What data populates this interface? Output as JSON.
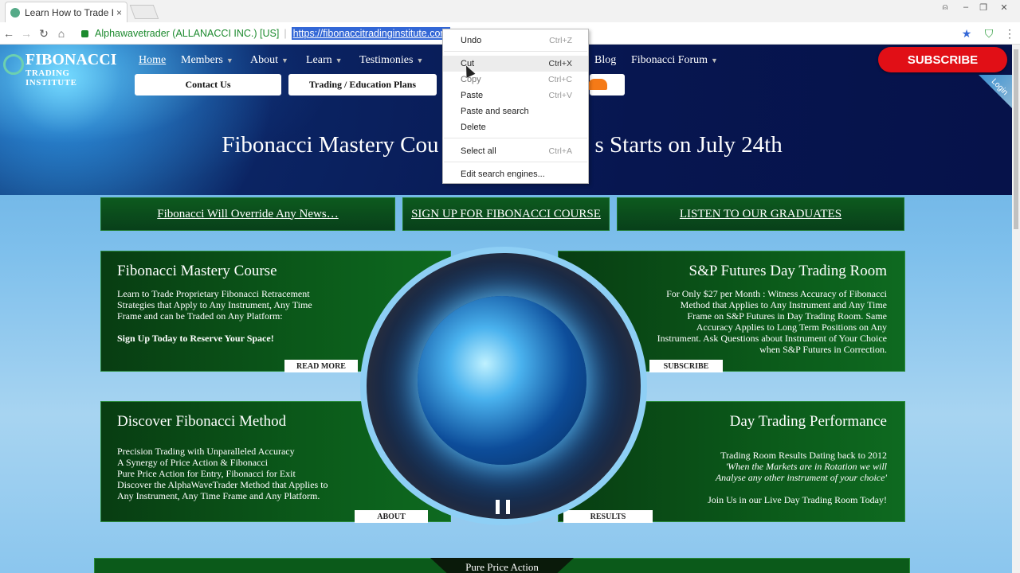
{
  "browser": {
    "tab_title": "Learn How to Trade Fibo",
    "tab_close": "×",
    "address": {
      "secure_label": "Alphawavetrader (ALLANACCI INC.) [US]",
      "url": "https://fibonaccitradinginstitute.com"
    },
    "window_buttons": [
      "⍝",
      "–",
      "❐",
      "✕"
    ]
  },
  "context_menu": {
    "items": [
      {
        "label": "Undo",
        "shortcut": "Ctrl+Z"
      },
      {
        "label": "Cut",
        "shortcut": "Ctrl+X"
      },
      {
        "label": "Copy",
        "shortcut": "Ctrl+C"
      },
      {
        "label": "Paste",
        "shortcut": "Ctrl+V"
      },
      {
        "label": "Paste and search",
        "shortcut": ""
      },
      {
        "label": "Delete",
        "shortcut": ""
      },
      {
        "label": "Select all",
        "shortcut": "Ctrl+A"
      },
      {
        "label": "Edit search engines...",
        "shortcut": ""
      }
    ]
  },
  "site": {
    "logo": {
      "line1": "FIBONACCI",
      "line2": "TRADING INSTITUTE"
    },
    "nav": {
      "home": "Home",
      "members": "Members",
      "about": "About",
      "learn": "Learn",
      "testimonies": "Testimonies",
      "blog": "Blog",
      "forum": "Fibonacci Forum"
    },
    "subscribe_button": "SUBSCRIBE",
    "login_corner": "Login",
    "sub_buttons": {
      "contact": "Contact Us",
      "plans": "Trading / Education Plans"
    },
    "hero_title_left": "Fibonacci Mastery Cou",
    "hero_title_right": "s Starts on July 24th",
    "green_buttons": {
      "news": "Fibonacci Will Override Any News…",
      "signup": "SIGN UP FOR FIBONACCI COURSE",
      "graduates": "LISTEN TO OUR GRADUATES"
    },
    "panels": {
      "mastery": {
        "title": "Fibonacci Mastery Course",
        "body": [
          "Learn to Trade Proprietary Fibonacci Retracement",
          "Strategies that Apply to Any Instrument, Any Time",
          "Frame and can be Traded on Any Platform:"
        ],
        "cta": "Sign Up Today to Reserve Your Space!",
        "button": "READ MORE"
      },
      "futures": {
        "title": "S&P Futures Day Trading Room",
        "body": [
          "For Only $27 per Month : Witness Accuracy of Fibonacci",
          "Method that Applies to Any Instrument and Any Time",
          "Frame on S&P Futures in Day Trading Room. Same",
          "Accuracy Applies to Long Term Positions on Any",
          "Instrument. Ask Questions about Instrument of Your Choice",
          "when S&P Futures in Correction."
        ],
        "button": "SUBSCRIBE"
      },
      "method": {
        "title": "Discover Fibonacci Method",
        "body": [
          "Precision Trading with Unparalleled Accuracy",
          "A Synergy of Price Action & Fibonacci",
          "Pure Price Action for Entry, Fibonacci for Exit",
          "Discover the AlphaWaveTrader Method that Applies to",
          "Any Instrument, Any Time Frame and Any Platform."
        ],
        "button": "ABOUT"
      },
      "performance": {
        "title": "Day Trading Performance",
        "body": [
          "Trading Room Results Dating back to 2012",
          "'When the Markets are in Rotation we will",
          "Analyse any other instrument of your choice'",
          "",
          "Join Us in our Live Day Trading Room Today!"
        ],
        "button": "RESULTS"
      }
    },
    "footer_tab": "Pure Price Action"
  }
}
